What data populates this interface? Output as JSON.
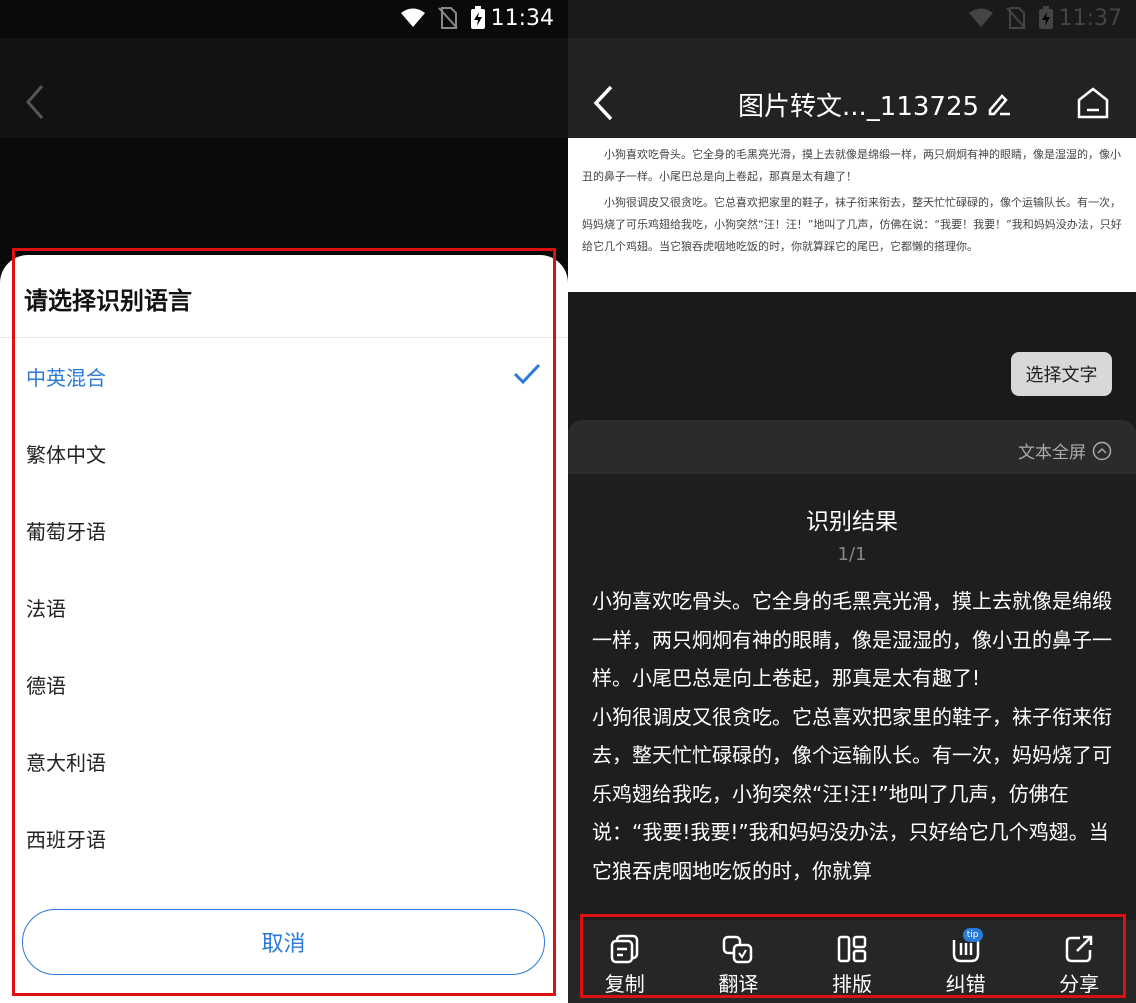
{
  "left": {
    "status": {
      "time": "11:34"
    },
    "sheet": {
      "title": "请选择识别语言",
      "languages": [
        {
          "label": "中英混合",
          "selected": true
        },
        {
          "label": "繁体中文",
          "selected": false
        },
        {
          "label": "葡萄牙语",
          "selected": false
        },
        {
          "label": "法语",
          "selected": false
        },
        {
          "label": "德语",
          "selected": false
        },
        {
          "label": "意大利语",
          "selected": false
        },
        {
          "label": "西班牙语",
          "selected": false
        }
      ],
      "cancel_label": "取消"
    }
  },
  "right": {
    "status": {
      "time": "11:37"
    },
    "title": "图片转文..._113725",
    "preview_paragraphs": [
      "小狗喜欢吃骨头。它全身的毛黑亮光滑，摸上去就像是绵缎一样，两只炯炯有神的眼睛，像是湿湿的，像小丑的鼻子一样。小尾巴总是向上卷起，那真是太有趣了！",
      "小狗很调皮又很贪吃。它总喜欢把家里的鞋子，袜子衔来衔去，整天忙忙碌碌的，像个运输队长。有一次，妈妈烧了可乐鸡翅给我吃，小狗突然“汪！汪！”地叫了几声，仿佛在说：“我要！我要！”我和妈妈没办法，只好给它几个鸡翅。当它狼吞虎咽地吃饭的时，你就算踩它的尾巴，它都懒的搭理你。"
    ],
    "select_text_label": "选择文字",
    "fullscreen_label": "文本全屏",
    "result_title": "识别结果",
    "page_indicator": "1/1",
    "result_paragraphs": [
      "小狗喜欢吃骨头。它全身的毛黑亮光滑，摸上去就像是绵缎一样，两只炯炯有神的眼睛，像是湿湿的，像小丑的鼻子一样。小尾巴总是向上卷起，那真是太有趣了!",
      "小狗很调皮又很贪吃。它总喜欢把家里的鞋子，袜子衔来衔去，整天忙忙碌碌的，像个运输队长。有一次，妈妈烧了可乐鸡翅给我吃，小狗突然“汪!汪!”地叫了几声，仿佛在说：“我要!我要!”我和妈妈没办法，只好给它几个鸡翅。当它狼吞虎咽地吃饭的时，你就算"
    ],
    "toolbar": {
      "copy": "复制",
      "translate": "翻译",
      "layout": "排版",
      "correct": "纠错",
      "correct_badge": "tip",
      "share": "分享"
    }
  },
  "colors": {
    "accent": "#2a7ad8",
    "highlight_box": "#dd1111"
  }
}
